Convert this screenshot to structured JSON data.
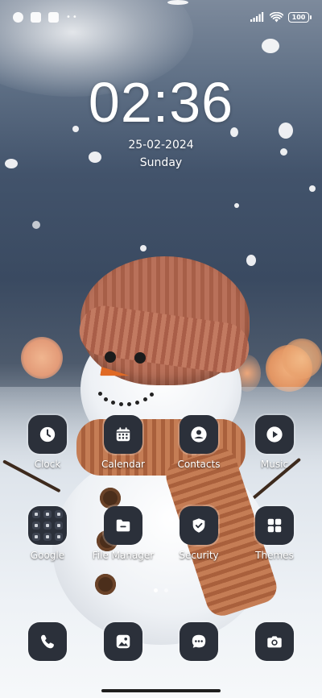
{
  "status_bar": {
    "battery": "100",
    "notification_icons": [
      "app-notification-icon",
      "square-icon",
      "document-icon"
    ],
    "overflow": "••"
  },
  "lockscreen": {
    "time": "02:36",
    "date": "25-02-2024",
    "day": "Sunday"
  },
  "apps": {
    "clock": {
      "label": "Clock",
      "icon": "clock-icon"
    },
    "calendar": {
      "label": "Calendar",
      "icon": "calendar-icon"
    },
    "contacts": {
      "label": "Contacts",
      "icon": "person-icon"
    },
    "music": {
      "label": "Music",
      "icon": "play-icon"
    },
    "google": {
      "label": "Google",
      "icon": "folder-icon"
    },
    "file_manager": {
      "label": "File Manager",
      "icon": "folder-icon"
    },
    "security": {
      "label": "Security",
      "icon": "shield-icon"
    },
    "themes": {
      "label": "Themes",
      "icon": "grid-icon"
    }
  },
  "dock": [
    "phone-icon",
    "gallery-icon",
    "messages-icon",
    "camera-icon"
  ],
  "pages": {
    "count": 2,
    "active": 1
  },
  "colors": {
    "icon_bg": "#2b303a",
    "accent": "#ffffff"
  }
}
